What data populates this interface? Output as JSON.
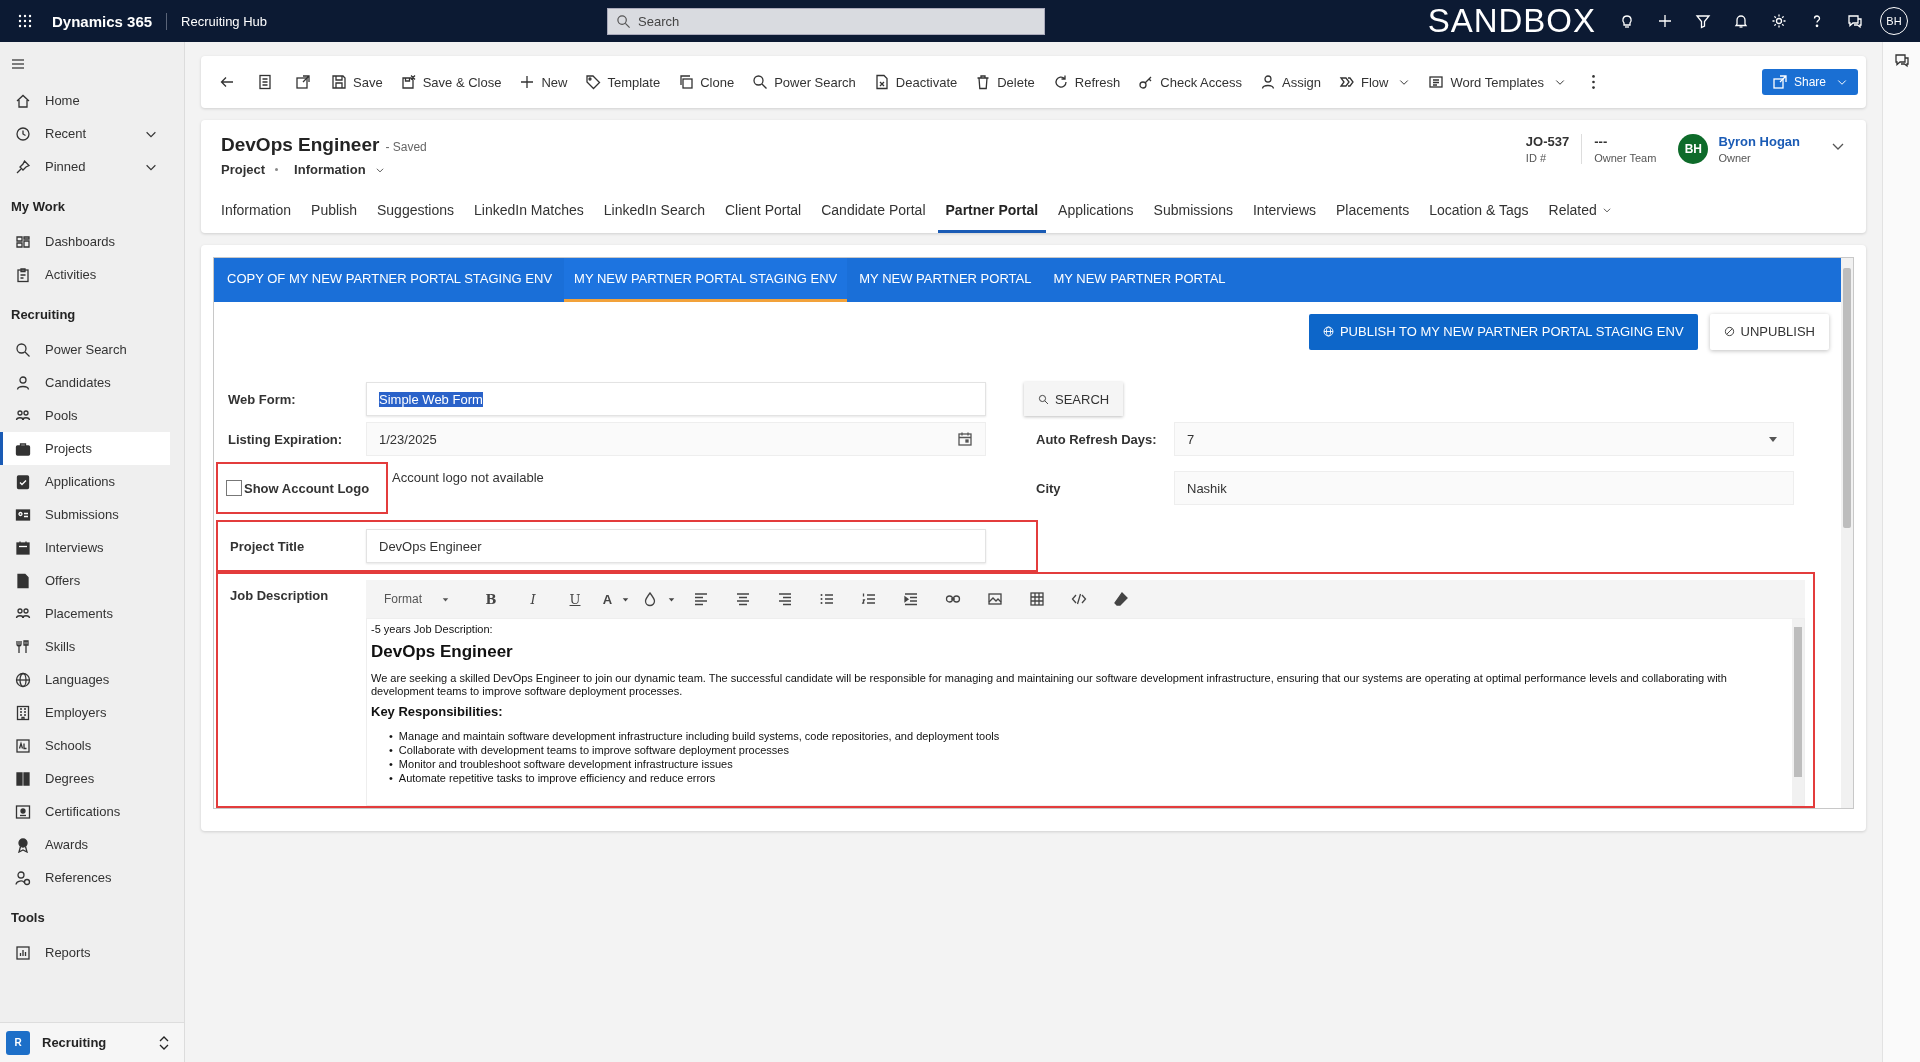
{
  "top_bar": {
    "app_name": "Dynamics 365",
    "area": "Recruiting Hub",
    "search": {
      "placeholder": "Search"
    },
    "environment": "SANDBOX",
    "avatar": "BH"
  },
  "sidebar": {
    "items": [
      {
        "label": "Home",
        "chevron": false,
        "selected": false
      },
      {
        "label": "Recent",
        "chevron": true,
        "selected": false
      },
      {
        "label": "Pinned",
        "chevron": true,
        "selected": false
      }
    ],
    "groups": [
      {
        "title": "My Work",
        "items": [
          {
            "label": "Dashboards",
            "selected": false
          },
          {
            "label": "Activities",
            "selected": false
          }
        ]
      },
      {
        "title": "Recruiting",
        "items": [
          {
            "label": "Power Search",
            "selected": false
          },
          {
            "label": "Candidates",
            "selected": false
          },
          {
            "label": "Pools",
            "selected": false
          },
          {
            "label": "Projects",
            "selected": true
          },
          {
            "label": "Applications",
            "selected": false
          },
          {
            "label": "Submissions",
            "selected": false
          },
          {
            "label": "Interviews",
            "selected": false
          },
          {
            "label": "Offers",
            "selected": false
          },
          {
            "label": "Placements",
            "selected": false
          },
          {
            "label": "Skills",
            "selected": false
          },
          {
            "label": "Languages",
            "selected": false
          },
          {
            "label": "Employers",
            "selected": false
          },
          {
            "label": "Schools",
            "selected": false
          },
          {
            "label": "Degrees",
            "selected": false
          },
          {
            "label": "Certifications",
            "selected": false
          },
          {
            "label": "Awards",
            "selected": false
          },
          {
            "label": "References",
            "selected": false
          }
        ]
      },
      {
        "title": "Tools",
        "items": [
          {
            "label": "Reports",
            "selected": false
          }
        ]
      }
    ],
    "area_switcher": {
      "badge": "R",
      "label": "Recruiting"
    }
  },
  "commands": [
    {
      "label": "Save",
      "dropdown": false
    },
    {
      "label": "Save & Close",
      "dropdown": false
    },
    {
      "label": "New",
      "dropdown": false
    },
    {
      "label": "Template",
      "dropdown": false
    },
    {
      "label": "Clone",
      "dropdown": false
    },
    {
      "label": "Power Search",
      "dropdown": false
    },
    {
      "label": "Deactivate",
      "dropdown": false
    },
    {
      "label": "Delete",
      "dropdown": false
    },
    {
      "label": "Refresh",
      "dropdown": false
    },
    {
      "label": "Check Access",
      "dropdown": false
    },
    {
      "label": "Assign",
      "dropdown": false
    },
    {
      "label": "Flow",
      "dropdown": true
    },
    {
      "label": "Word Templates",
      "dropdown": true
    }
  ],
  "share_button": {
    "label": "Share"
  },
  "record": {
    "title": "DevOps Engineer",
    "status": "- Saved",
    "entity": "Project",
    "form": "Information",
    "fields": [
      {
        "value": "JO-537",
        "label": "ID #"
      },
      {
        "value": "---",
        "label": "Owner Team"
      }
    ],
    "owner": {
      "initials": "BH",
      "name": "Byron Hogan",
      "label": "Owner"
    }
  },
  "tabs": [
    {
      "label": "Information",
      "selected": false,
      "dropdown": false
    },
    {
      "label": "Publish",
      "selected": false,
      "dropdown": false
    },
    {
      "label": "Suggestions",
      "selected": false,
      "dropdown": false
    },
    {
      "label": "LinkedIn Matches",
      "selected": false,
      "dropdown": false
    },
    {
      "label": "LinkedIn Search",
      "selected": false,
      "dropdown": false
    },
    {
      "label": "Client Portal",
      "selected": false,
      "dropdown": false
    },
    {
      "label": "Candidate Portal",
      "selected": false,
      "dropdown": false
    },
    {
      "label": "Partner Portal",
      "selected": true,
      "dropdown": false
    },
    {
      "label": "Applications",
      "selected": false,
      "dropdown": false
    },
    {
      "label": "Submissions",
      "selected": false,
      "dropdown": false
    },
    {
      "label": "Interviews",
      "selected": false,
      "dropdown": false
    },
    {
      "label": "Placements",
      "selected": false,
      "dropdown": false
    },
    {
      "label": "Location & Tags",
      "selected": false,
      "dropdown": false
    },
    {
      "label": "Related",
      "selected": false,
      "dropdown": true
    }
  ],
  "portal": {
    "tabs": [
      {
        "label": "COPY OF MY NEW PARTNER PORTAL STAGING ENV",
        "selected": false
      },
      {
        "label": "MY NEW PARTNER PORTAL STAGING ENV",
        "selected": true
      },
      {
        "label": "MY NEW PARTNER PORTAL",
        "selected": false
      },
      {
        "label": "MY NEW PARTNER PORTAL",
        "selected": false
      }
    ],
    "publish_button": "PUBLISH TO MY NEW PARTNER PORTAL STAGING ENV",
    "unpublish_button": "UNPUBLISH",
    "web_form": {
      "label": "Web Form:",
      "value": "Simple Web Form",
      "text_selected": true
    },
    "search_button": "SEARCH",
    "listing_expiration": {
      "label": "Listing Expiration:",
      "value": "1/23/2025"
    },
    "auto_refresh_days": {
      "label": "Auto Refresh Days:",
      "value": "7"
    },
    "show_account_logo": {
      "label": "Show Account Logo",
      "checked": false,
      "highlighted": true,
      "note": "Account logo not available"
    },
    "city": {
      "label": "City",
      "value": "Nashik"
    },
    "project_title": {
      "label": "Project Title",
      "value": "DevOps Engineer",
      "highlighted": true
    },
    "job_description": {
      "label": "Job Description",
      "highlighted": true,
      "toolbar": {
        "format": "Format",
        "text_buttons": [
          "B",
          "I",
          "U"
        ],
        "font_color": "A"
      },
      "content": [
        {
          "kind": "paragraph",
          "text": "-5 years Job Description:"
        },
        {
          "kind": "heading",
          "text": "DevOps Engineer"
        },
        {
          "kind": "paragraph",
          "text": "We are seeking a skilled DevOps Engineer to join our dynamic team. The successful candidate will be responsible for managing and maintaining our software development infrastructure, ensuring that our systems are operating at optimal performance levels and collaborating with development teams to improve software deployment processes."
        },
        {
          "kind": "subheading",
          "text": "Key Responsibilities:"
        },
        {
          "kind": "bullets",
          "marker": "•",
          "items": [
            "Manage and maintain software development infrastructure including build systems, code repositories, and deployment tools",
            "Collaborate with development teams to improve software deployment processes",
            "Monitor and troubleshoot software development infrastructure issues",
            "Automate repetitive tasks to improve efficiency and reduce errors"
          ]
        }
      ]
    }
  }
}
